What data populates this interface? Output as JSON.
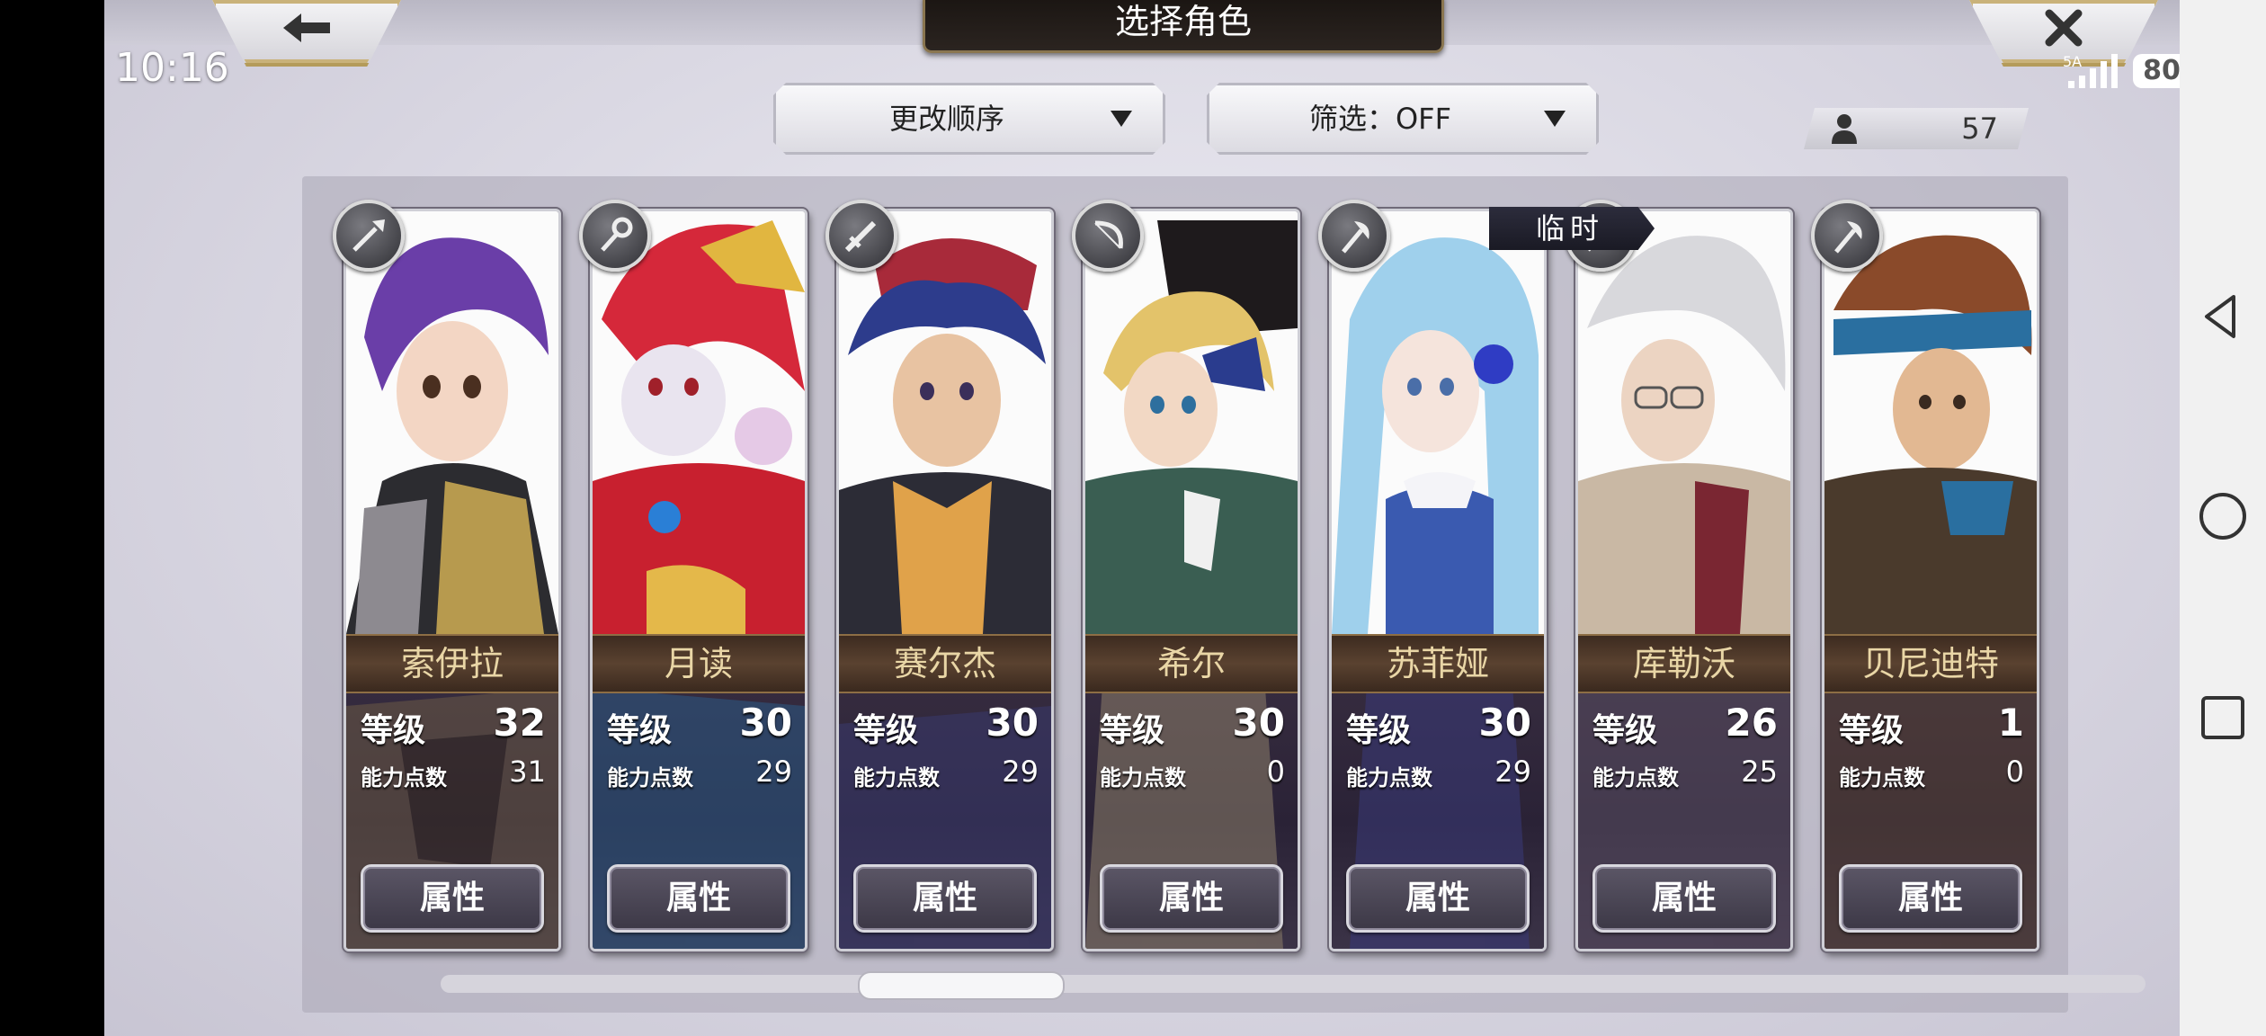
{
  "status": {
    "time": "10:16",
    "network": "5A",
    "battery": "80"
  },
  "header": {
    "title": "选择角色"
  },
  "controls": {
    "sort_label": "更改顺序",
    "filter_label": "筛选：OFF"
  },
  "roster_count": "57",
  "temp_tag": "临时",
  "stats_labels": {
    "level": "等级",
    "ability_points": "能力点数",
    "attributes_button": "属性"
  },
  "characters": [
    {
      "name": "索伊拉",
      "level": "32",
      "ability_points": "31",
      "weapon": "spear-icon"
    },
    {
      "name": "月读",
      "level": "30",
      "ability_points": "29",
      "weapon": "staff-icon"
    },
    {
      "name": "赛尔杰",
      "level": "30",
      "ability_points": "29",
      "weapon": "sword-icon"
    },
    {
      "name": "希尔",
      "level": "30",
      "ability_points": "0",
      "weapon": "bow-icon"
    },
    {
      "name": "苏菲娅",
      "level": "30",
      "ability_points": "29",
      "weapon": "axe-icon"
    },
    {
      "name": "库勒沃",
      "level": "26",
      "ability_points": "25",
      "weapon": "staff-icon"
    },
    {
      "name": "贝尼迪特",
      "level": "1",
      "ability_points": "0",
      "weapon": "axe-icon"
    }
  ],
  "colors": {
    "card_frame": "#cfcfd6",
    "name_text": "#e9d6a6",
    "panel": "#aaa6b4"
  }
}
